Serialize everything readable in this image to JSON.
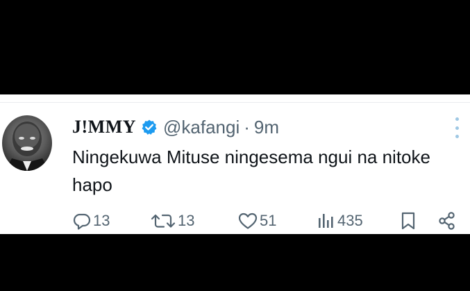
{
  "tweet": {
    "author_name": "J!MMY",
    "handle": "@kafangi",
    "separator": "·",
    "time": "9m",
    "text": "Ningekuwa Mituse ningesema ngui na nitoke hapo",
    "stats": {
      "replies": "13",
      "retweets": "13",
      "likes": "51",
      "views": "435"
    },
    "icons": [
      "reply-icon",
      "retweet-icon",
      "like-icon",
      "views-icon",
      "bookmark-icon",
      "share-icon",
      "verified-badge-icon",
      "more-icon"
    ],
    "colors": {
      "verified": "#1d9bf0",
      "secondary_text": "#536471",
      "primary_text": "#0f1419"
    }
  }
}
